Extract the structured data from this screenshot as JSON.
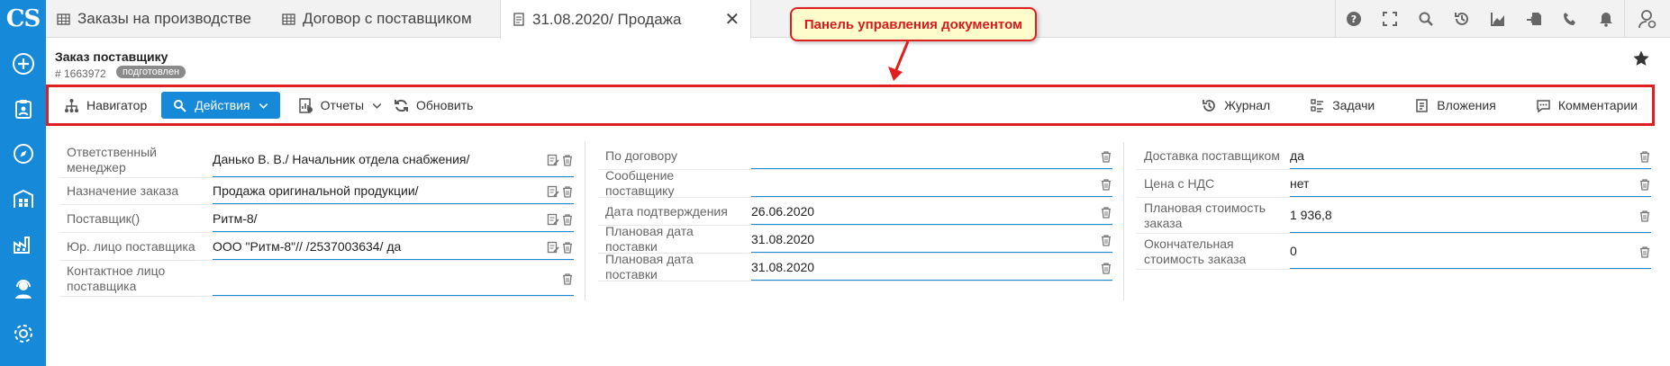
{
  "app": {
    "logo": "CS"
  },
  "tabs": [
    {
      "label": "Заказы на производстве"
    },
    {
      "label": "Договор с поставщиком"
    },
    {
      "label": "31.08.2020/ Продажа",
      "close": "✕"
    }
  ],
  "callout": {
    "text": "Панель управления документом"
  },
  "document": {
    "title": "Заказ поставщику",
    "number": "# 1663972",
    "status": "подготовлен"
  },
  "toolbar": {
    "navigator": "Навигатор",
    "actions": "Действия",
    "reports": "Отчеты",
    "refresh": "Обновить",
    "journal": "Журнал",
    "tasks": "Задачи",
    "attachments": "Вложения",
    "comments": "Комментарии"
  },
  "form": {
    "left": [
      {
        "label": "Ответственный менеджер",
        "value": "Данько В. В./ Начальник отдела снабжения/"
      },
      {
        "label": "Назначение заказа",
        "value": "Продажа оригинальной продукции/"
      },
      {
        "label": "Поставщик()",
        "value": "Ритм-8/"
      },
      {
        "label": "Юр. лицо поставщика",
        "value": "ООО \"Ритм-8\"// /2537003634/ да"
      },
      {
        "label": "Контактное лицо поставщика",
        "value": ""
      }
    ],
    "middle": [
      {
        "label": "По договору",
        "value": ""
      },
      {
        "label": "Сообщение поставщику",
        "value": ""
      },
      {
        "label": "Дата подтверждения",
        "value": "26.06.2020"
      },
      {
        "label": "Плановая дата поставки",
        "value": "31.08.2020"
      },
      {
        "label": "Плановая дата поставки",
        "value": "31.08.2020"
      }
    ],
    "right": [
      {
        "label": "Доставка поставщиком",
        "value": "да"
      },
      {
        "label": "Цена с НДС",
        "value": "нет"
      },
      {
        "label": "Плановая стоимость заказа",
        "value": "1 936,8"
      },
      {
        "label": "Окончательная стоимость заказа",
        "value": "0"
      }
    ]
  },
  "colors": {
    "accent": "#1689d8",
    "callout_border": "#e02020",
    "callout_bg": "#fffccc"
  }
}
